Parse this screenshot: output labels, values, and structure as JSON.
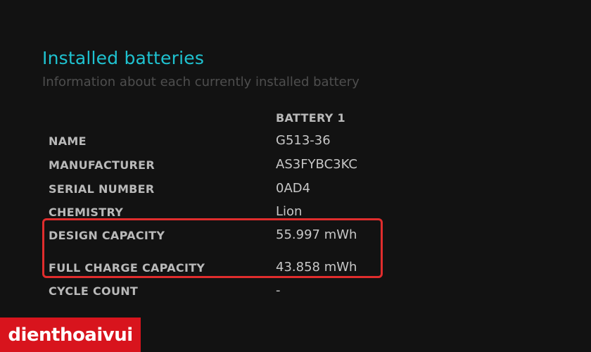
{
  "section": {
    "title": "Installed batteries",
    "subtitle": "Information about each currently installed battery"
  },
  "table": {
    "column_header": "BATTERY 1",
    "rows": [
      {
        "label": "NAME",
        "value": "G513-36"
      },
      {
        "label": "MANUFACTURER",
        "value": "AS3FYBC3KC"
      },
      {
        "label": "SERIAL NUMBER",
        "value": "0AD4"
      },
      {
        "label": "CHEMISTRY",
        "value": "Lion"
      },
      {
        "label": "DESIGN CAPACITY",
        "value": "55.997 mWh"
      },
      {
        "label": "FULL CHARGE CAPACITY",
        "value": "43.858 mWh"
      },
      {
        "label": "CYCLE COUNT",
        "value": "-"
      }
    ]
  },
  "logo": {
    "text": "dienthoaivui"
  },
  "colors": {
    "title": "#1fc2d0",
    "highlight": "#e02d2d",
    "logo_bg": "#d8141d",
    "background": "#121212"
  }
}
